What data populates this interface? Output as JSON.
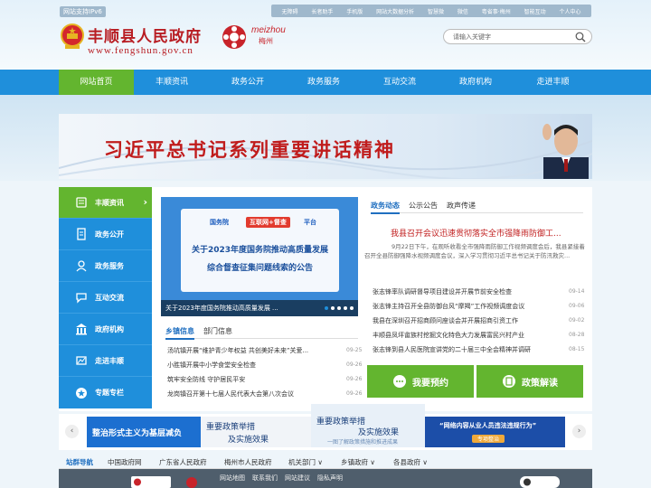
{
  "header": {
    "ipv6_label": "网站支持IPv6",
    "tools": [
      "无障碍",
      "长者助手",
      "手机版",
      "网站大数据分析",
      "智慧微",
      "微信",
      "粤省事·梅州",
      "智能互动",
      "个人中心"
    ],
    "site_title": "丰顺县人民政府",
    "site_url": "www.fengshun.gov.cn",
    "partner_logo_pinyin": "meizhou",
    "partner_logo_name": "梅州",
    "search_placeholder": "请输入关键字"
  },
  "nav": {
    "items": [
      "网站首页",
      "丰顺资讯",
      "政务公开",
      "政务服务",
      "互动交流",
      "政府机构",
      "走进丰顺"
    ],
    "active_index": 0
  },
  "banner": {
    "title": "习近平总书记系列重要讲话精神"
  },
  "sidebar": {
    "items": [
      "丰顺资讯",
      "政务公开",
      "政务服务",
      "互动交流",
      "政府机构",
      "走进丰顺",
      "专题专栏"
    ],
    "active_index": 0
  },
  "carousel": {
    "tags": [
      "国务院",
      "互联网+督查",
      "平台"
    ],
    "image_line1": "关于2023年度国务院推动高质量发展",
    "image_line2": "综合督查征集问题线索的公告",
    "caption": "关于2023年度国务院推动高质量发展 ...",
    "slide_count": 5,
    "active_slide": 0
  },
  "township_news": {
    "tabs": [
      "乡镇信息",
      "部门信息"
    ],
    "active_tab": 0,
    "items": [
      {
        "title": "汤坑镇开展“维护青少年权益 共创美好未来”关爱...",
        "date": "09-25"
      },
      {
        "title": "小胜镇开展中小学食堂安全检查",
        "date": "09-26"
      },
      {
        "title": "筑牢安全防线 守护居民平安",
        "date": "09-26"
      },
      {
        "title": "龙岗镇召开第十七届人民代表大会第八次会议",
        "date": "09-26"
      }
    ]
  },
  "gov_news": {
    "tabs": [
      "政务动态",
      "公示公告",
      "政声传递"
    ],
    "active_tab": 0,
    "headline": "我县召开会议迅速贯彻落实全市强降雨防御工...",
    "summary": "9月22日下午，在观听收看全市强降雨防御工作视频调度会后，我县紧接着召开全县防御强降水视频调度会议，深入学习贯彻习近平总书记关于防汛救灾...",
    "items": [
      {
        "title": "张志锋率队调研督导项目建设并开展节前安全检查",
        "date": "09-14"
      },
      {
        "title": "张志锋主持召开全县防御台风“摩羯”工作视频调度会议",
        "date": "09-06"
      },
      {
        "title": "我县在深圳召开招商顾问座谈会并开展招商引资工作",
        "date": "09-02"
      },
      {
        "title": "丰顺县凤坪畲族村挖掘文化特色大力发展富民兴村产业",
        "date": "08-28"
      },
      {
        "title": "张志锋到县人民医院宣讲党的二十届三中全会精神并调研",
        "date": "08-15"
      }
    ]
  },
  "quick_buttons": [
    "我要预约",
    "政策解读"
  ],
  "promos": {
    "p1_line1": "整治形式主义为基层减负",
    "p2_title": "重要政策举措",
    "p2_subtitle": "及实施效果",
    "p3_line1": "一图了解政策措施和推进成果",
    "p4_line1": "“网络内容从业人员违法违规行为”",
    "p4_line2": "专项整治"
  },
  "site_links": {
    "label": "站群导航",
    "items": [
      "中国政府网",
      "广东省人民政府",
      "梅州市人民政府",
      "机关部门",
      "乡镇政府",
      "各县政府"
    ]
  },
  "footer": {
    "links": [
      "网站地图",
      "联系我们",
      "网站建议",
      "隐私声明"
    ]
  },
  "colors": {
    "primary": "#1f8fdb",
    "accent_green": "#63b52f",
    "title_red": "#b81c22",
    "footer_bg": "#4f5e6c"
  }
}
